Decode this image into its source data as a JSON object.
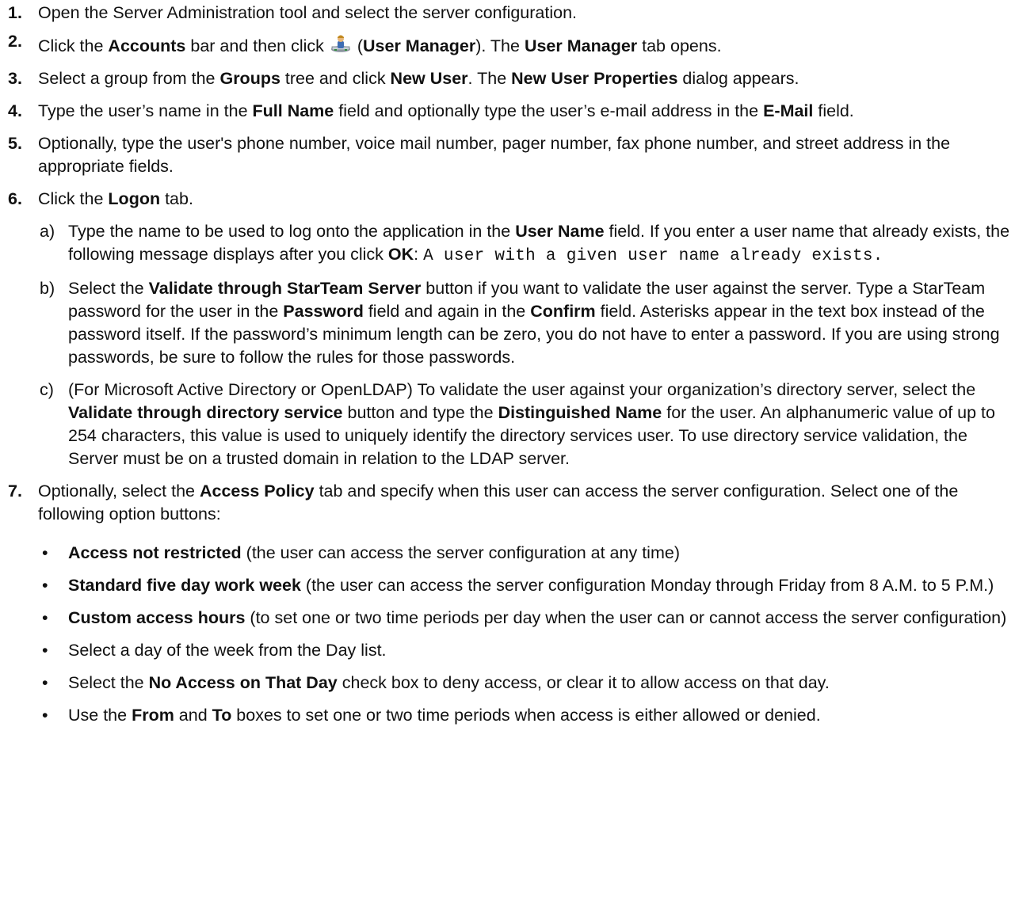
{
  "steps": [
    {
      "num": "1.",
      "t1": "Open the Server Administration tool and select the server configuration."
    },
    {
      "num": "2.",
      "t1": "Click the ",
      "b1": "Accounts",
      "t2": " bar and then click ",
      "icon": "user-manager-icon",
      "t3": " (",
      "b2": "User Manager",
      "t4": "). The ",
      "b3": "User Manager",
      "t5": " tab opens."
    },
    {
      "num": "3.",
      "t1": "Select a group from the ",
      "b1": "Groups",
      "t2": " tree and click ",
      "b2": "New User",
      "t3": ". The ",
      "b3": "New User Properties",
      "t4": " dialog appears."
    },
    {
      "num": "4.",
      "t1": "Type the user’s name in the ",
      "b1": "Full Name",
      "t2": " field and optionally type the user’s e-mail address in the ",
      "b2": "E-Mail",
      "t3": " field."
    },
    {
      "num": "5.",
      "t1": "Optionally, type the user's phone number, voice mail number, pager number, fax phone number, and street address in the appropriate fields."
    },
    {
      "num": "6.",
      "t1": "Click the ",
      "b1": "Logon",
      "t2": " tab."
    },
    {
      "num": "7.",
      "t1": "Optionally, select the ",
      "b1": "Access Policy",
      "t2": " tab and specify when this user can access the server configuration. Select one of the following option buttons:"
    }
  ],
  "substeps": [
    {
      "label": "a)",
      "t1": "Type the name to be used to log onto the application in the ",
      "b1": "User Name",
      "t2": " field. If you enter a user name that already exists, the following message displays after you click ",
      "b2": "OK",
      "t3": ": ",
      "code": "A user with a given user name already exists."
    },
    {
      "label": "b)",
      "t1": "Select the ",
      "b1": "Validate through StarTeam Server",
      "t2": " button if you want to validate the user against the server. Type a StarTeam password for the user in the ",
      "b2": "Password",
      "t3": " field and again in the ",
      "b3": "Confirm",
      "t4": " field. Asterisks appear in the text box instead of the password itself. If the password’s minimum length can be zero, you do not have to enter a password. If you are using strong passwords, be sure to follow the rules for those passwords."
    },
    {
      "label": "c)",
      "t1": "(For Microsoft Active Directory or OpenLDAP) To validate the user against your organization’s directory server, select the ",
      "b1": "Validate through directory service",
      "t2": " button and type the ",
      "b2": "Distinguished Name",
      "t3": " for the user. An alphanumeric value of up to 254 characters, this value is used to uniquely identify the directory services user. To use directory service validation, the Server must be on a trusted domain in relation to the LDAP server."
    }
  ],
  "bullets": [
    {
      "dot": "•",
      "b1": "Access not restricted",
      "t1": " (the user can access the server configuration at any time)"
    },
    {
      "dot": "•",
      "b1": "Standard five day work week",
      "t1": " (the user can access the server configuration Monday through Friday from 8 A.M. to 5 P.M.)"
    },
    {
      "dot": "•",
      "b1": "Custom access hours",
      "t1": " (to set one or two time periods per day when the user can or cannot access the server configuration)"
    },
    {
      "dot": "•",
      "t1": "Select a day of the week from the Day list."
    },
    {
      "dot": "•",
      "t1": "Select the ",
      "b1": "No Access on That Day",
      "t2": " check box to deny access, or clear it to allow access on that day."
    },
    {
      "dot": "•",
      "t1": "Use the ",
      "b1": "From",
      "t2": " and ",
      "b2": "To",
      "t3": " boxes to set one or two time periods when access is either allowed or denied."
    }
  ]
}
